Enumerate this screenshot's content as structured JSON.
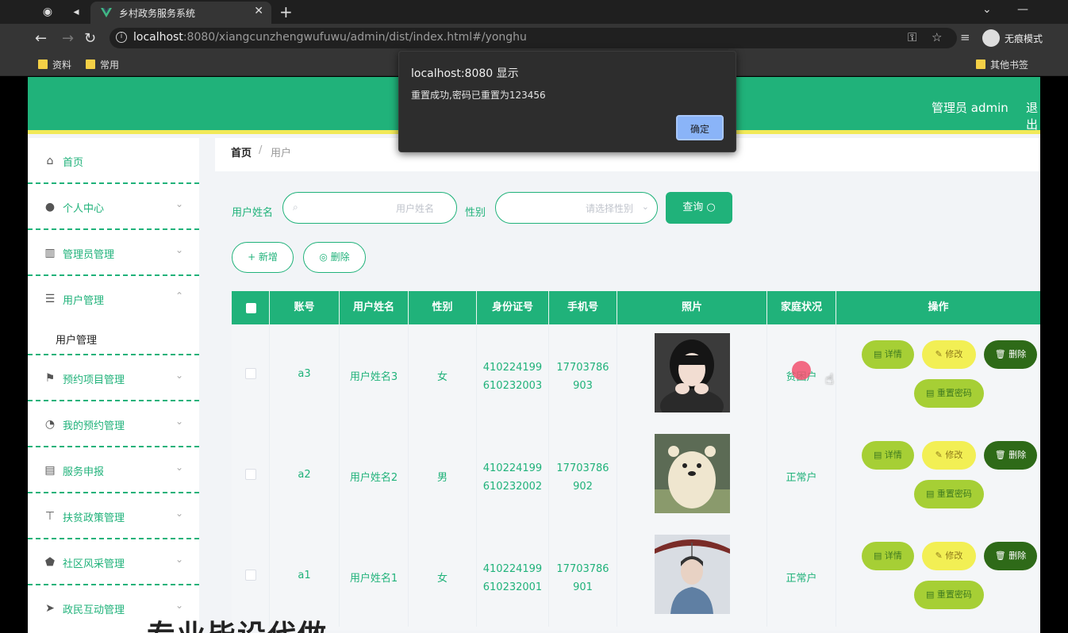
{
  "browser": {
    "tab_title": "乡村政务服务系统",
    "url_host": "localhost",
    "url_rest": ":8080/xiangcunzhengwufuwu/admin/dist/index.html#/yonghu",
    "incognito_label": "无痕模式",
    "bookmarks": [
      "资料",
      "常用"
    ],
    "other_bookmarks": "其他书签"
  },
  "dialog": {
    "title": "localhost:8080 显示",
    "message": "重置成功,密码已重置为123456",
    "ok_label": "确定"
  },
  "header": {
    "admin_label": "管理员 admin",
    "logout_label": "退出"
  },
  "sidebar": {
    "items": [
      {
        "label": "首页",
        "icon": "home-icon"
      },
      {
        "label": "个人中心",
        "icon": "user-icon"
      },
      {
        "label": "管理员管理",
        "icon": "chart-icon"
      },
      {
        "label": "用户管理",
        "icon": "list-icon"
      },
      {
        "label": "预约项目管理",
        "icon": "flag-icon"
      },
      {
        "label": "我的预约管理",
        "icon": "phone-icon"
      },
      {
        "label": "服务申报",
        "icon": "server-icon"
      },
      {
        "label": "扶贫政策管理",
        "icon": "sign-icon"
      },
      {
        "label": "社区风采管理",
        "icon": "shield-icon"
      },
      {
        "label": "政民互动管理",
        "icon": "send-icon"
      }
    ],
    "active_sub": "用户管理"
  },
  "breadcrumb": {
    "home": "首页",
    "sep": "/",
    "current": "用户"
  },
  "search": {
    "name_label": "用户姓名",
    "name_placeholder": "用户姓名",
    "gender_label": "性别",
    "gender_placeholder": "请选择性别",
    "query_label": "查询 ○"
  },
  "toolbar": {
    "add_label": "+ 新增",
    "delete_label": "◎ 删除"
  },
  "table": {
    "headers": [
      "账号",
      "用户姓名",
      "性别",
      "身份证号",
      "手机号",
      "照片",
      "家庭状况",
      "操作"
    ],
    "actions": {
      "detail": "▤ 详情",
      "edit": "✎ 修改",
      "delete": "🗑 删除",
      "reset": "▤ 重置密码"
    },
    "rows": [
      {
        "account": "a3",
        "name": "用户姓名3",
        "gender": "女",
        "id1": "410224199",
        "id2": "610232003",
        "phone1": "17703786",
        "phone2": "903",
        "status": "贫困户"
      },
      {
        "account": "a2",
        "name": "用户姓名2",
        "gender": "男",
        "id1": "410224199",
        "id2": "610232002",
        "phone1": "17703786",
        "phone2": "902",
        "status": "正常户"
      },
      {
        "account": "a1",
        "name": "用户姓名1",
        "gender": "女",
        "id1": "410224199",
        "id2": "610232001",
        "phone1": "17703786",
        "phone2": "901",
        "status": "正常户"
      }
    ]
  },
  "watermark": "专业毕设代做",
  "colors": {
    "primary": "#20b27a",
    "accent": "#f1e958"
  }
}
